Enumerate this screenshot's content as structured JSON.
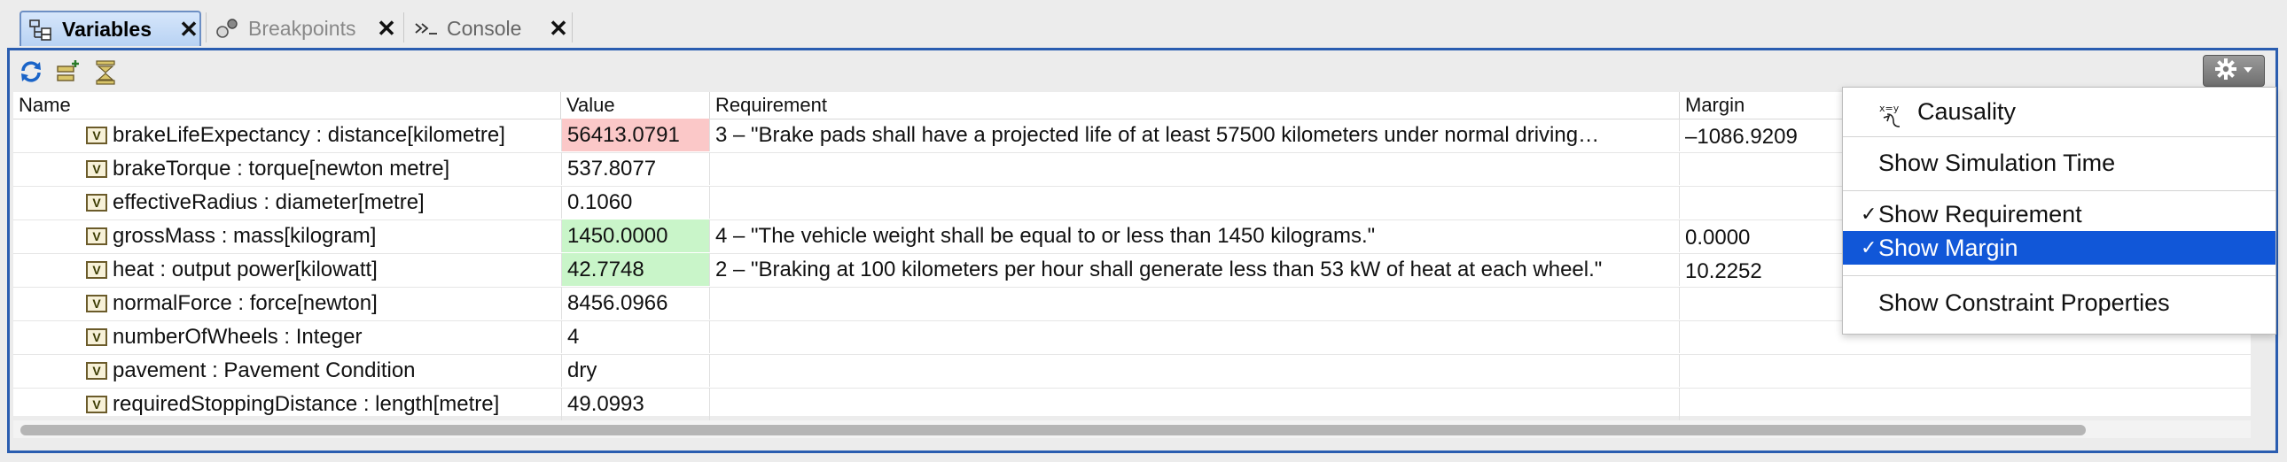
{
  "tabs": [
    {
      "label": "Variables",
      "active": true,
      "icon": "variables-icon"
    },
    {
      "label": "Breakpoints",
      "active": false,
      "icon": "breakpoints-icon"
    },
    {
      "label": "Console",
      "active": false,
      "icon": "console-icon"
    }
  ],
  "close_glyph": "✕",
  "toolbar": {
    "buttons": [
      "refresh-icon",
      "expand-all-icon",
      "collapse-all-icon"
    ]
  },
  "columns": {
    "name": "Name",
    "value": "Value",
    "requirement": "Requirement",
    "margin": "Margin"
  },
  "rows": [
    {
      "name": "brakeLifeExpectancy : distance[kilometre]",
      "value": "56413.0791",
      "status": "fail",
      "requirement": "3 – \"Brake pads shall have a projected life of at least 57500 kilometers under normal driving…",
      "margin": "–1086.9209"
    },
    {
      "name": "brakeTorque : torque[newton metre]",
      "value": "537.8077",
      "status": "none",
      "requirement": "",
      "margin": ""
    },
    {
      "name": "effectiveRadius : diameter[metre]",
      "value": "0.1060",
      "status": "none",
      "requirement": "",
      "margin": ""
    },
    {
      "name": "grossMass : mass[kilogram]",
      "value": "1450.0000",
      "status": "pass",
      "requirement": "4 – \"The vehicle weight shall be equal to or less than 1450 kilograms.\"",
      "margin": "0.0000"
    },
    {
      "name": "heat : output power[kilowatt]",
      "value": "42.7748",
      "status": "pass",
      "requirement": "2 – \"Braking at 100 kilometers per hour shall generate less than 53 kW of heat at each wheel.\"",
      "margin": "10.2252"
    },
    {
      "name": "normalForce : force[newton]",
      "value": "8456.0966",
      "status": "none",
      "requirement": "",
      "margin": ""
    },
    {
      "name": "numberOfWheels : Integer",
      "value": "4",
      "status": "none",
      "requirement": "",
      "margin": ""
    },
    {
      "name": "pavement : Pavement Condition",
      "value": "dry",
      "status": "none",
      "requirement": "",
      "margin": ""
    },
    {
      "name": "requiredStoppingDistance : length[metre]",
      "value": "49.0993",
      "status": "none",
      "requirement": "",
      "margin": ""
    }
  ],
  "variable_badge": "V",
  "menu": {
    "items": [
      {
        "label": "Causality",
        "checked": false,
        "selected": false
      },
      {
        "label": "Show Simulation Time",
        "checked": false,
        "selected": false
      },
      {
        "label": "Show Requirement",
        "checked": true,
        "selected": false
      },
      {
        "label": "Show Margin",
        "checked": true,
        "selected": true
      },
      {
        "label": "Show Constraint Properties",
        "checked": false,
        "selected": false
      }
    ],
    "check_glyph": "✓",
    "causality_icon_text": "x=y"
  },
  "colors": {
    "fail_bg": "#fbc8c8",
    "pass_bg": "#c9f5c9",
    "selection": "#1157d8",
    "panel_border": "#2a5db0"
  }
}
